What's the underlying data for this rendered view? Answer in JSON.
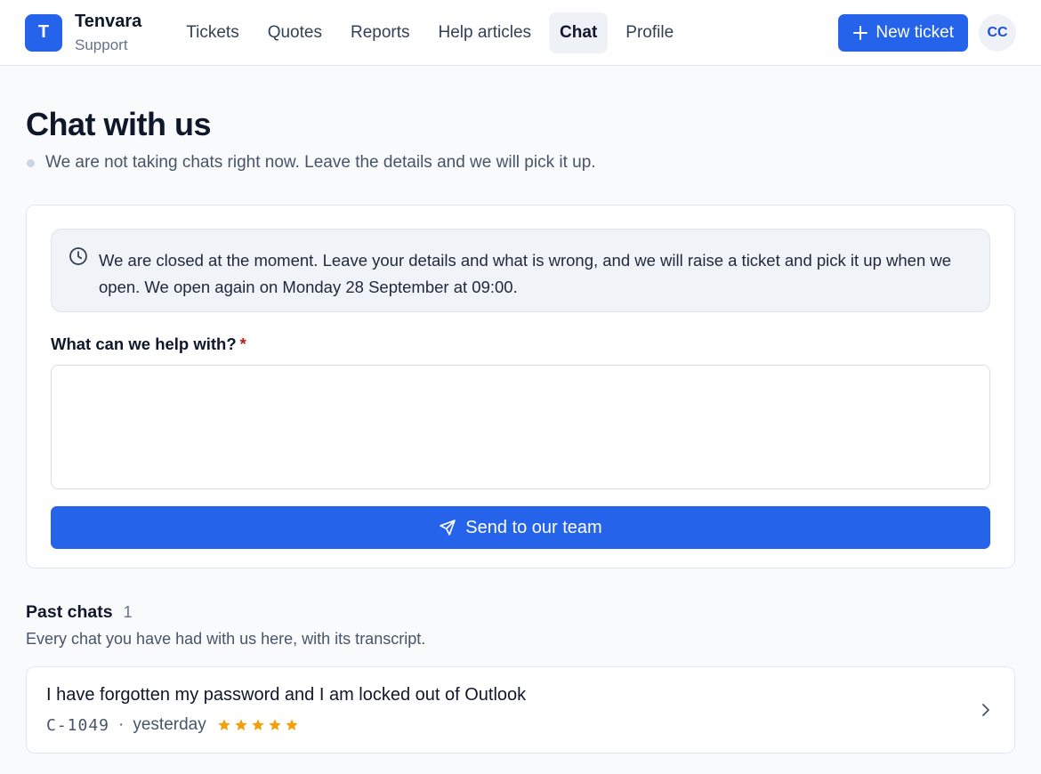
{
  "brand": {
    "logo_letter": "T",
    "name": "Tenvara",
    "sub": "Support"
  },
  "nav": {
    "items": [
      {
        "label": "Tickets"
      },
      {
        "label": "Quotes"
      },
      {
        "label": "Reports"
      },
      {
        "label": "Help articles"
      },
      {
        "label": "Chat",
        "active": true
      },
      {
        "label": "Profile"
      }
    ]
  },
  "header": {
    "new_ticket_label": "New ticket",
    "avatar_initials": "CC"
  },
  "page": {
    "title": "Chat with us",
    "status": "We are not taking chats right now. Leave the details and we will pick it up."
  },
  "form": {
    "notice": "We are closed at the moment. Leave your details and what is wrong, and we will raise a ticket and pick it up when we open. We open again on Monday 28 September at 09:00.",
    "field_label": "What can we help with?",
    "required_mark": "*",
    "message_value": "",
    "message_placeholder": "",
    "send_label": "Send to our team"
  },
  "past_chats": {
    "title": "Past chats",
    "count": "1",
    "subtitle": "Every chat you have had with us here, with its transcript.",
    "items": [
      {
        "title": "I have forgotten my password and I am locked out of Outlook",
        "id": "C-1049",
        "separator": "·",
        "when": "yesterday",
        "rating": 5,
        "rating_max": 5
      }
    ]
  },
  "colors": {
    "accent": "#2563eb",
    "star": "#f59e0b",
    "required": "#b91c1c",
    "status_dot": "#cbd5e1"
  },
  "icons": {
    "plus": "plus-icon",
    "clock": "clock-icon",
    "send": "send-icon",
    "star": "star-icon",
    "chevron": "chevron-right-icon"
  }
}
